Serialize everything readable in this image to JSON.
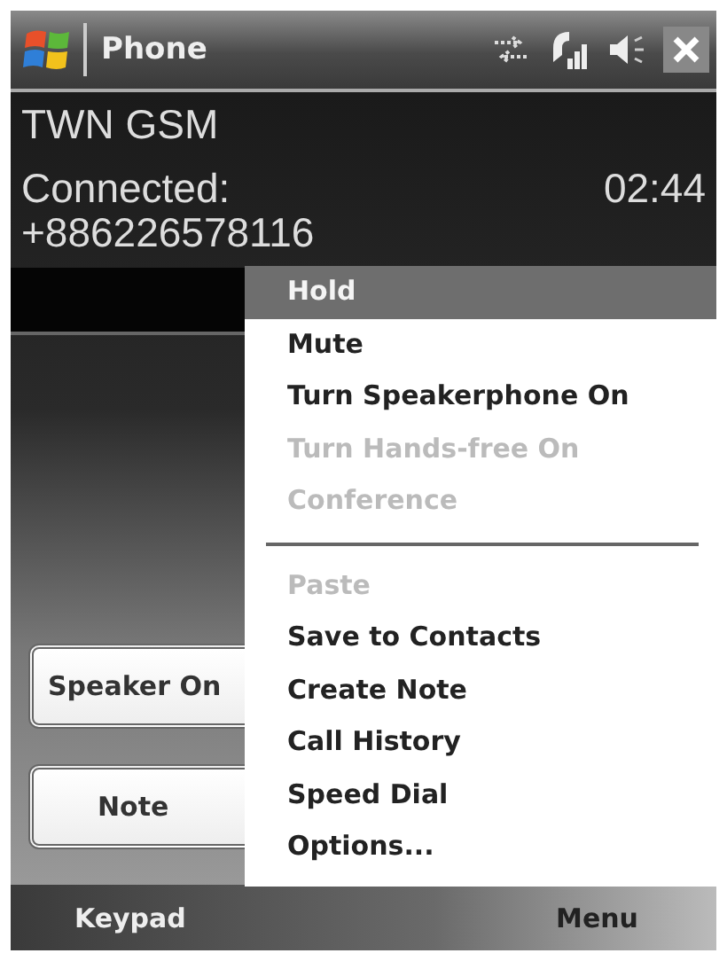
{
  "title_bar": {
    "title": "Phone"
  },
  "call": {
    "network": "TWN GSM",
    "status": "Connected:",
    "timer": "02:44",
    "number": "+886226578116"
  },
  "buttons": [
    {
      "label": "Speaker On"
    },
    {
      "label": "Note"
    }
  ],
  "menu": [
    {
      "kind": "item",
      "label": "Hold",
      "selected": true,
      "disabled": false
    },
    {
      "kind": "item",
      "label": "Mute",
      "selected": false,
      "disabled": false
    },
    {
      "kind": "item",
      "label": "Turn Speakerphone On",
      "selected": false,
      "disabled": false
    },
    {
      "kind": "item",
      "label": "Turn Hands-free On",
      "selected": false,
      "disabled": true
    },
    {
      "kind": "item",
      "label": "Conference",
      "selected": false,
      "disabled": true
    },
    {
      "kind": "separator"
    },
    {
      "kind": "item",
      "label": "Paste",
      "selected": false,
      "disabled": true
    },
    {
      "kind": "item",
      "label": "Save to Contacts",
      "selected": false,
      "disabled": false
    },
    {
      "kind": "item",
      "label": "Create Note",
      "selected": false,
      "disabled": false
    },
    {
      "kind": "item",
      "label": "Call History",
      "selected": false,
      "disabled": false
    },
    {
      "kind": "item",
      "label": "Speed Dial",
      "selected": false,
      "disabled": false
    },
    {
      "kind": "item",
      "label": "Options...",
      "selected": false,
      "disabled": false
    }
  ],
  "softkeys": {
    "left": "Keypad",
    "right": "Menu"
  }
}
